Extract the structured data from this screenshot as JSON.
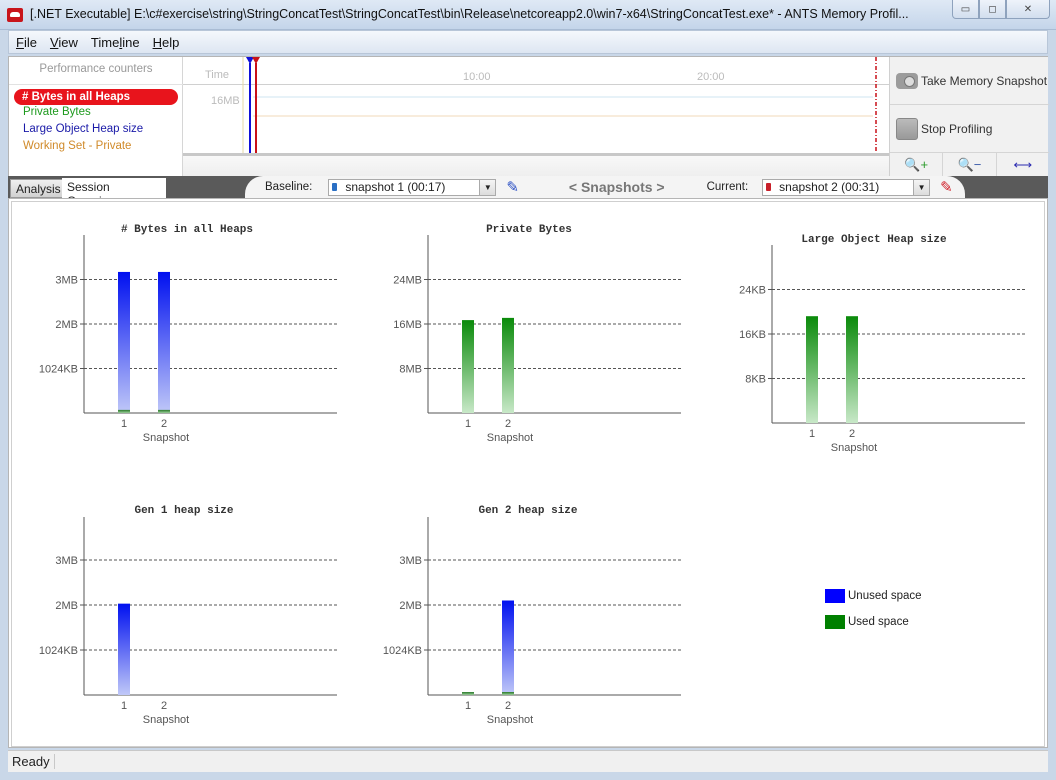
{
  "window": {
    "title": "[.NET Executable] E:\\c#exercise\\string\\StringConcatTest\\StringConcatTest\\bin\\Release\\netcoreapp2.0\\win7-x64\\StringConcatTest.exe* - ANTS Memory Profil...",
    "minimize": "▭",
    "maximize": "◻",
    "close": "✕"
  },
  "menu": [
    {
      "accel": "F",
      "rest": "ile"
    },
    {
      "accel": "V",
      "rest": "iew"
    },
    {
      "pre": "Time",
      "accel": "l",
      "rest": "ine"
    },
    {
      "accel": "H",
      "rest": "elp"
    }
  ],
  "counters": {
    "heading": "Performance counters",
    "items": [
      {
        "label": "# Bytes in all Heaps",
        "color": "#ffffff",
        "active": true
      },
      {
        "label": "Private Bytes",
        "color": "#1e9a1e"
      },
      {
        "label": "Large Object Heap size",
        "color": "#1a1aa8"
      },
      {
        "label": "Working Set - Private",
        "color": "#d08a2a"
      }
    ]
  },
  "timeline": {
    "time_label": "Time",
    "y_label": "16MB",
    "ticks": [
      "10:00",
      "20:00"
    ]
  },
  "actions": {
    "take_snapshot": "Take Memory Snapshot",
    "stop_profiling": "Stop Profiling",
    "zoom_in": "🔍+",
    "zoom_out": "🔍−",
    "fit": "⟷"
  },
  "tabs": {
    "analysis": "Analysis",
    "overview": "Session Overview"
  },
  "snapshots": {
    "baseline_label": "Baseline:",
    "baseline_value": "snapshot 1 (00:17)",
    "nav": "< Snapshots >",
    "current_label": "Current:",
    "current_value": "snapshot 2 (00:31)",
    "baseline_color": "#2a6fc4",
    "current_color": "#c8202a"
  },
  "legend": {
    "unused": "Unused space",
    "used": "Used space",
    "unused_color": "#0000ff",
    "used_color": "#008000"
  },
  "status": "Ready",
  "chart_data": [
    {
      "type": "bar",
      "title": "# Bytes in all Heaps",
      "xlabel": "Snapshot",
      "categories": [
        "1",
        "2"
      ],
      "yticks": [
        {
          "v": 1,
          "label": "1024KB"
        },
        {
          "v": 2,
          "label": "2MB"
        },
        {
          "v": 3,
          "label": "3MB"
        }
      ],
      "unit": "MB",
      "ylim": [
        0,
        4
      ],
      "series": [
        {
          "name": "Used space",
          "values": [
            0.07,
            0.07
          ]
        },
        {
          "name": "Unused space",
          "values": [
            3.1,
            3.1
          ]
        }
      ]
    },
    {
      "type": "bar",
      "title": "Private Bytes",
      "xlabel": "Snapshot",
      "categories": [
        "1",
        "2"
      ],
      "yticks": [
        {
          "v": 8,
          "label": "8MB"
        },
        {
          "v": 16,
          "label": "16MB"
        },
        {
          "v": 24,
          "label": "24MB"
        }
      ],
      "unit": "MB",
      "ylim": [
        0,
        32
      ],
      "series": [
        {
          "name": "Used space",
          "values": [
            16.7,
            17.1
          ]
        }
      ]
    },
    {
      "type": "bar",
      "title": "Large Object Heap size",
      "xlabel": "Snapshot",
      "categories": [
        "1",
        "2"
      ],
      "yticks": [
        {
          "v": 8,
          "label": "8KB"
        },
        {
          "v": 16,
          "label": "16KB"
        },
        {
          "v": 24,
          "label": "24KB"
        }
      ],
      "unit": "KB",
      "ylim": [
        0,
        32
      ],
      "series": [
        {
          "name": "Used space",
          "values": [
            19.2,
            19.2
          ]
        }
      ]
    },
    {
      "type": "bar",
      "title": "Gen 1 heap size",
      "xlabel": "Snapshot",
      "categories": [
        "1",
        "2"
      ],
      "yticks": [
        {
          "v": 1,
          "label": "1024KB"
        },
        {
          "v": 2,
          "label": "2MB"
        },
        {
          "v": 3,
          "label": "3MB"
        }
      ],
      "unit": "MB",
      "ylim": [
        0,
        4
      ],
      "series": [
        {
          "name": "Used space",
          "values": [
            0,
            0
          ]
        },
        {
          "name": "Unused space",
          "values": [
            2.03,
            0
          ]
        }
      ]
    },
    {
      "type": "bar",
      "title": "Gen 2 heap size",
      "xlabel": "Snapshot",
      "categories": [
        "1",
        "2"
      ],
      "yticks": [
        {
          "v": 1,
          "label": "1024KB"
        },
        {
          "v": 2,
          "label": "2MB"
        },
        {
          "v": 3,
          "label": "3MB"
        }
      ],
      "unit": "MB",
      "ylim": [
        0,
        4
      ],
      "series": [
        {
          "name": "Used space",
          "values": [
            0.06,
            0.06
          ]
        },
        {
          "name": "Unused space",
          "values": [
            0,
            2.04
          ]
        }
      ]
    }
  ]
}
